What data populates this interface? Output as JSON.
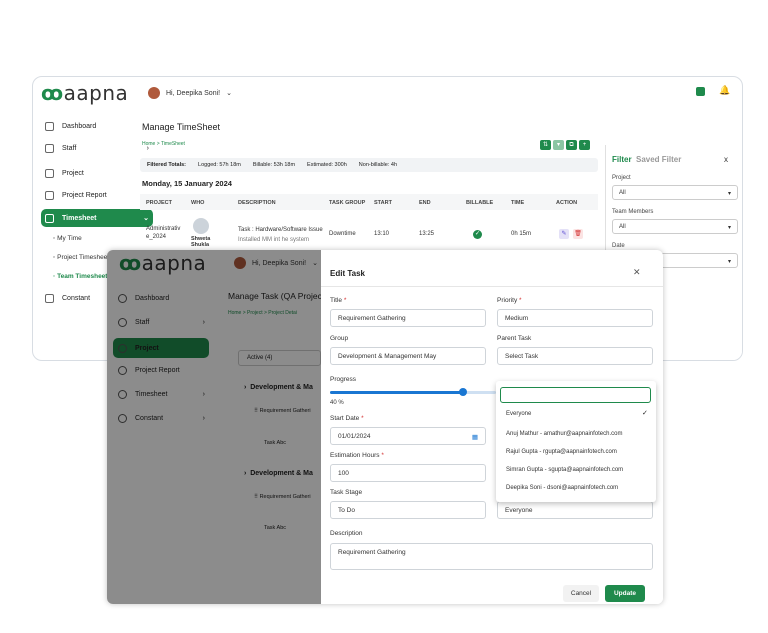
{
  "brand": {
    "logo_text": "aapna",
    "accent": "#1f8a4c"
  },
  "win1": {
    "user_greeting": "Hi, Deepika Soni!",
    "sidebar": [
      {
        "label": "Dashboard",
        "icon": "home-icon"
      },
      {
        "label": "Staff",
        "icon": "users-icon"
      },
      {
        "label": "Project",
        "icon": "list-icon"
      },
      {
        "label": "Project Report",
        "icon": "report-icon"
      },
      {
        "label": "Timesheet",
        "icon": "clock-icon"
      },
      {
        "label": "Constant",
        "icon": "gear-icon"
      }
    ],
    "sub_items": [
      "My Time",
      "Project Timesheet",
      "Team Timesheet"
    ],
    "title": "Manage TimeSheet",
    "breadcrumb": "Home  >  TimeSheet",
    "totals": {
      "label": "Filtered Totals:",
      "logged": "Logged: 57h 18m",
      "billable": "Billable: 53h 18m",
      "estimated": "Estimated: 300h",
      "nonbillable": "Non-billable: 4h"
    },
    "date_heading": "Monday, 15 January 2024",
    "columns": [
      "PROJECT",
      "WHO",
      "DESCRIPTION",
      "TASK GROUP",
      "START",
      "END",
      "BILLABLE",
      "TIME",
      "ACTION"
    ],
    "row": {
      "project": "Administrativ e_2024",
      "who": "Shweta Shukla",
      "desc1": "Task : Hardware/Software Issue",
      "desc2": "Installed MM int he system",
      "group": "Downtime",
      "start": "13:10",
      "end": "13:25",
      "time": "0h 15m"
    },
    "filter": {
      "tab_active": "Filter",
      "tab_other": "Saved Filter",
      "close": "x",
      "project_label": "Project",
      "project_value": "All",
      "team_label": "Team Members",
      "team_value": "All",
      "date_label": "Date"
    }
  },
  "win2": {
    "user_greeting": "Hi, Deepika Soni!",
    "sidebar": [
      "Dashboard",
      "Staff",
      "Project",
      "Project Report",
      "Timesheet",
      "Constant"
    ],
    "title": "Manage Task (QA Project",
    "breadcrumb": "Home  >  Project  >  Project Detai",
    "active_tab": "Active (4)",
    "group1": "Development & Ma",
    "item1": "Requirement Gatheri",
    "task1": "Task Abc",
    "group2": "Development & Ma",
    "item2": "Requirement Gatheri",
    "task2": "Task Abc"
  },
  "modal": {
    "title": "Edit Task",
    "close": "✕",
    "title_label": "Title",
    "title_value": "Requirement Gathering",
    "priority_label": "Priority",
    "priority_value": "Medium",
    "group_label": "Group",
    "group_value": "Development & Management May",
    "parent_label": "Parent Task",
    "parent_value": "Select Task",
    "progress_label": "Progress",
    "progress_value": "40 %",
    "progress_fraction": 0.4,
    "start_label": "Start Date",
    "start_value": "01/01/2024",
    "est_label": "Estimation Hours",
    "est_value": "100",
    "stage_label": "Task Stage",
    "stage_value": "To Do",
    "assignee_value": "Everyone",
    "desc_label": "Description",
    "desc_value": "Requirement Gathering",
    "cancel": "Cancel",
    "update": "Update",
    "dropdown": [
      "Everyone",
      "Anuj Mathur - amathur@aapnainfotech.com",
      "Rajul Gupta - rgupta@aapnainfotech.com",
      "Simran Gupta - sgupta@aapnainfotech.com",
      "Deepika Soni - dsoni@aapnainfotech.com"
    ]
  }
}
